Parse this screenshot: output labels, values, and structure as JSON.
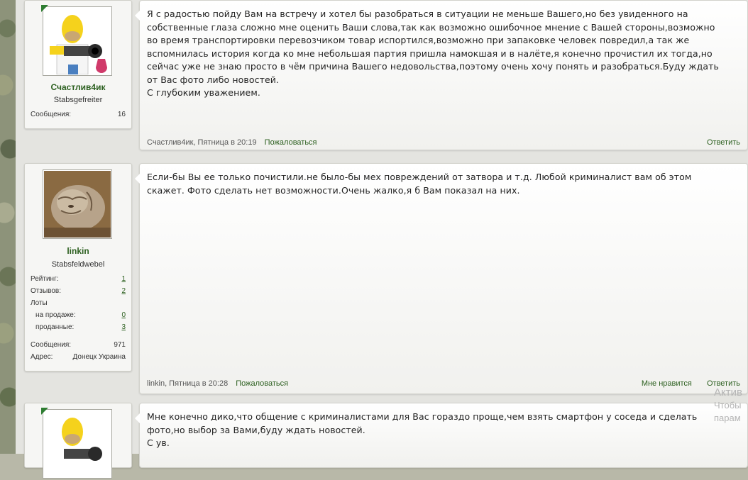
{
  "posts": [
    {
      "username": "Счастлив4ик",
      "rank": "Stabsgefreiter",
      "stats": [
        {
          "label": "Сообщения:",
          "value": "16"
        }
      ],
      "text": "Я с радостью пойду Вам на встречу и хотел бы разобраться в ситуации не меньше Вашего,но без увиденного на\nсобственные глаза сложно мне оценить Ваши слова,так как возможно ошибочное мнение с Вашей стороны,возможно\nво время транспортировки перевозчиком товар испортился,возможно при запаковке человек повредил,а так же\nвспомнилась история когда ко мне небольшая партия пришла намокшая и в налёте,я конечно прочистил их тогда,но\nсейчас уже не знаю просто в чём причина Вашего недовольства,поэтому очень хочу понять и разобраться.Буду ждать\nот Вас фото либо новостей.\nС глубоким уважением.",
      "author_time": "Счастлив4ик, Пятница в 20:19",
      "report": "Пожаловаться",
      "reply": "Ответить"
    },
    {
      "username": "linkin",
      "rank": "Stabsfeldwebel",
      "stats": [
        {
          "label": "Рейтинг:",
          "value": "1"
        },
        {
          "label": "Отзывов:",
          "value": "2"
        },
        {
          "label": "Лоты",
          "value": ""
        },
        {
          "label": "на продаже:",
          "value": "0"
        },
        {
          "label": "проданные:",
          "value": "3"
        },
        {
          "label": "Сообщения:",
          "value": "971"
        },
        {
          "label": "Адрес:",
          "value": "Донецк Украина"
        }
      ],
      "text": "Если-бы Вы ее только почистили.не было-бы мех повреждений от затвора и т.д. Любой криминалист вам об этом\nскажет. Фото сделать нет возможности.Очень жалко,я б Вам показал на них.",
      "author_time": "linkin, Пятница в 20:28",
      "report": "Пожаловаться",
      "like": "Мне нравится",
      "reply": "Ответить"
    },
    {
      "text": "Мне конечно дико,что общение с криминалистами для Вас гораздо проще,чем взять смартфон у соседа и сделать\nфото,но выбор за Вами,буду ждать новостей.\nС ув."
    }
  ],
  "windows_activation": {
    "line1": "Актив",
    "line2": "Чтобы",
    "line3": "парам"
  }
}
